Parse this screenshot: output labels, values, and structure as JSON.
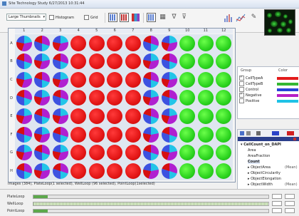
{
  "window": {
    "title": "Site Technology Study 6/27/2013 10:31:44"
  },
  "toolbar": {
    "view_mode": "Large Thumbnails",
    "show_chk_label": "Histogram",
    "grid_label": "Grid"
  },
  "plate": {
    "columns": [
      "1",
      "2",
      "3",
      "4",
      "5",
      "6",
      "7",
      "8",
      "9",
      "10",
      "11",
      "12"
    ],
    "rows": [
      "A",
      "B",
      "C",
      "D",
      "E",
      "F",
      "G",
      "H"
    ],
    "col_colors": [
      "pie",
      "pie",
      "pie",
      "red",
      "red",
      "red",
      "red",
      "pie",
      "pie",
      "green",
      "green",
      "green"
    ]
  },
  "status": {
    "text": "Images (384), PlateLoop(1 selected), WellLoop (96 selected), PointLoop(1selected)"
  },
  "legend": {
    "headers": {
      "group": "Group",
      "color": "Color"
    },
    "items": [
      {
        "name": "CellTypeA",
        "checked": true,
        "color": "#e31b1b"
      },
      {
        "name": "CellTypeB",
        "checked": false,
        "color": "#33b833"
      },
      {
        "name": "Control",
        "checked": false,
        "color": "#2742d8"
      },
      {
        "name": "Negative",
        "checked": true,
        "color": "#b61ec6"
      },
      {
        "name": "Positive",
        "checked": false,
        "color": "#1fc2e6"
      }
    ]
  },
  "features": {
    "items": [
      {
        "label": "▾ CellCount_on_DAPI",
        "bold": true,
        "suffix": ""
      },
      {
        "label": "Area",
        "bold": false,
        "suffix": ""
      },
      {
        "label": "AreaFraction",
        "bold": false,
        "suffix": ""
      },
      {
        "label": "Count",
        "bold": true,
        "suffix": ""
      },
      {
        "label": "▸ ObjectArea",
        "bold": false,
        "suffix": "(Mean)"
      },
      {
        "label": "▸ ObjectCircularity",
        "bold": false,
        "suffix": ""
      },
      {
        "label": "▸ ObjectElongation",
        "bold": false,
        "suffix": ""
      },
      {
        "label": "▸ ObjectWidth",
        "bold": false,
        "suffix": "(Mean)"
      }
    ]
  },
  "loops": [
    {
      "label": "PlateLoop",
      "fill": 0.06,
      "striped": false
    },
    {
      "label": "WellLoop",
      "fill": 1.0,
      "striped": true
    },
    {
      "label": "PointLoop",
      "fill": 0.06,
      "striped": false
    }
  ]
}
